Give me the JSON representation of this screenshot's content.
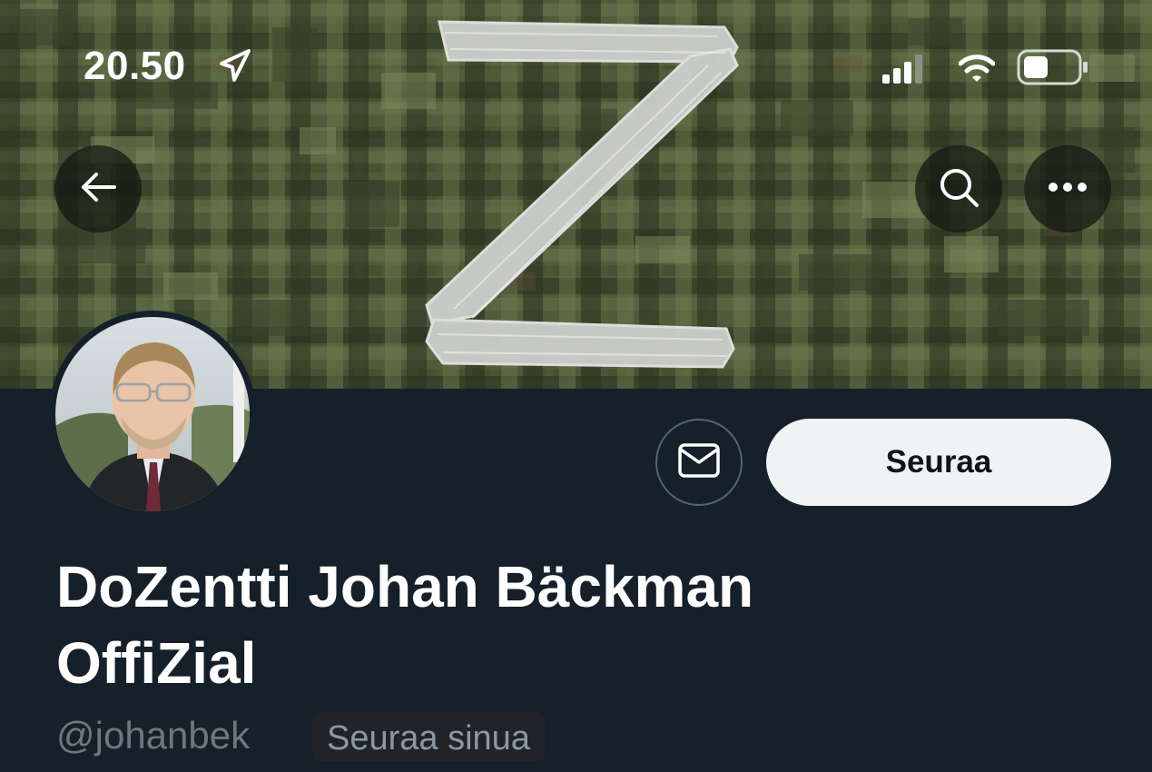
{
  "status_bar": {
    "time": "20.50",
    "location_icon": "location-arrow-icon",
    "signal_icon": "cellular-signal-icon",
    "wifi_icon": "wifi-icon",
    "battery_icon": "battery-icon"
  },
  "header": {
    "banner_motif": "Z",
    "back_icon": "back-arrow-icon",
    "search_icon": "search-icon",
    "more_icon": "more-horizontal-icon"
  },
  "profile": {
    "display_name": "DoZentti Johan Bäckman OffiZial",
    "handle": "@johanbek",
    "follows_you_label": "Seuraa sinua",
    "message_icon": "mail-icon",
    "follow_button_label": "Seuraa"
  },
  "colors": {
    "background": "#15202b",
    "follow_button_bg": "#eff3f4",
    "follow_button_text": "#0f1419",
    "handle_text": "#71767b",
    "camo_green": "#4f5b3a"
  }
}
